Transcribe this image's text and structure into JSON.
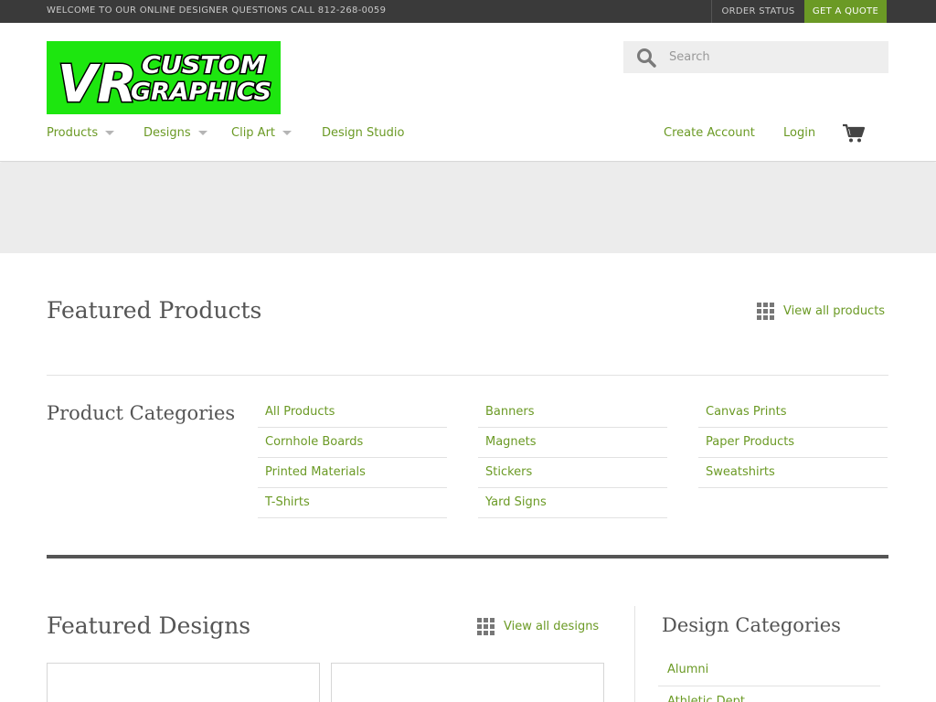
{
  "topbar": {
    "welcome": "WELCOME TO OUR ONLINE DESIGNER QUESTIONS CALL 812-268-0059",
    "order_status": "ORDER STATUS",
    "get_quote": "GET A QUOTE"
  },
  "logo": {
    "line1": "VR",
    "line2": "CUSTOM",
    "line3": "GRAPHICS",
    "colors": {
      "background": "#1de60f",
      "text": "#ffffff",
      "outline": "#000000"
    }
  },
  "search": {
    "placeholder": "Search",
    "icon": "search-icon"
  },
  "nav": {
    "products": "Products",
    "designs": "Designs",
    "clip_art": "Clip Art",
    "design_studio": "Design Studio",
    "create_account": "Create Account",
    "login": "Login",
    "cart_icon": "cart-icon"
  },
  "featured_products": {
    "title": "Featured Products",
    "view_all": "View all products"
  },
  "product_categories": {
    "title": "Product Categories",
    "col1": [
      "All Products",
      "Cornhole Boards",
      "Printed Materials",
      "T-Shirts"
    ],
    "col2": [
      "Banners",
      "Magnets",
      "Stickers",
      "Yard Signs"
    ],
    "col3": [
      "Canvas Prints",
      "Paper Products",
      "Sweatshirts"
    ]
  },
  "featured_designs": {
    "title": "Featured Designs",
    "view_all": "View all designs"
  },
  "design_categories": {
    "title": "Design Categories",
    "items": [
      "Alumni",
      "Athletic Dept."
    ]
  },
  "colors": {
    "accent": "#6b9a25",
    "topbar": "#3a3a3a",
    "banner": "#ececec"
  }
}
